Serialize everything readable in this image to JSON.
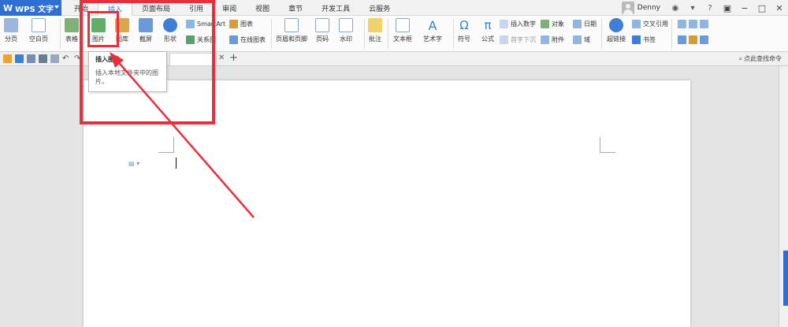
{
  "app": {
    "name": "WPS 文字",
    "logo": "W"
  },
  "tabs": [
    "开始",
    "插入",
    "页面布局",
    "引用",
    "审阅",
    "视图",
    "章节",
    "开发工具",
    "云服务"
  ],
  "active_tab": 1,
  "user": {
    "name": "Denny"
  },
  "ribbon": {
    "page_break": "分页",
    "blank_page": "空白页",
    "table": "表格",
    "picture": "图片",
    "gallery": "图库",
    "screenshot": "截屏",
    "shapes": "形状",
    "smartart": "SmartArt",
    "relation": "关系图",
    "chart": "图表",
    "online_chart": "在线图表",
    "header_footer": "页眉和页脚",
    "page_number": "页码",
    "watermark": "水印",
    "comment": "批注",
    "textbox": "文本框",
    "wordart": "艺术字",
    "symbol": "符号",
    "formula": "公式",
    "insert_number": "插入数字",
    "object": "对象",
    "date": "日期",
    "dropcap": "首字下沉",
    "attachment": "附件",
    "field": "域",
    "hyperlink": "超链接",
    "crossref": "交叉引用",
    "bookmark": "书签"
  },
  "search_command": "点此查找命令",
  "tooltip": {
    "title": "插入图片",
    "desc": "插入本地文件夹中的图片。"
  },
  "colors": {
    "accent": "#2e6fd1",
    "highlight": "#ea2e3b"
  }
}
